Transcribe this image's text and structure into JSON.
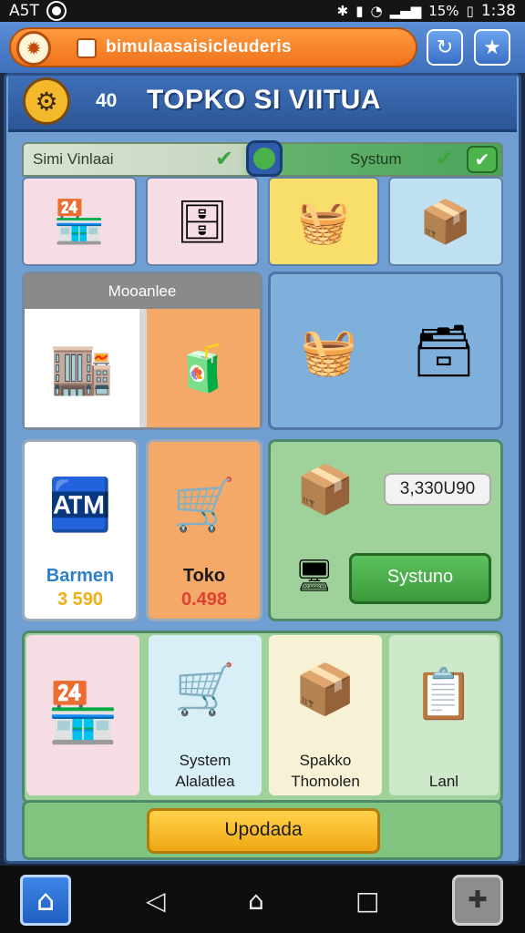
{
  "status": {
    "carrier": "A5T",
    "signal_text": "15%",
    "time": "1:38"
  },
  "appbar": {
    "url_text": "bimulaasaisicleuderis",
    "refresh_icon": "refresh-icon",
    "star_icon": "star-icon"
  },
  "title": {
    "level": "40",
    "text": "TOPKO SI VIITUA"
  },
  "section1": {
    "left_label": "Simi Vinlaai",
    "right_label": "Systum"
  },
  "section2": {
    "header": "Mooanlee"
  },
  "row3": {
    "card1": {
      "name": "Barmen",
      "value": "3 590"
    },
    "card2": {
      "name": "Toko",
      "value": "0.498"
    },
    "card3": {
      "amount": "3,330U90",
      "button": "Systuno"
    }
  },
  "row4": {
    "card1": {
      "name": ""
    },
    "card2": {
      "line1": "System",
      "line2": "Alalatlea"
    },
    "card3": {
      "line1": "Spakko",
      "line2": "Thomolen"
    },
    "card4": {
      "line1": "Lanl"
    }
  },
  "footer": {
    "button": "Upodada"
  },
  "colors": {
    "accent_orange": "#f0731c",
    "primary_blue": "#3d6fbb",
    "success_green": "#4cb54c",
    "cta_yellow": "#f5b71e"
  }
}
